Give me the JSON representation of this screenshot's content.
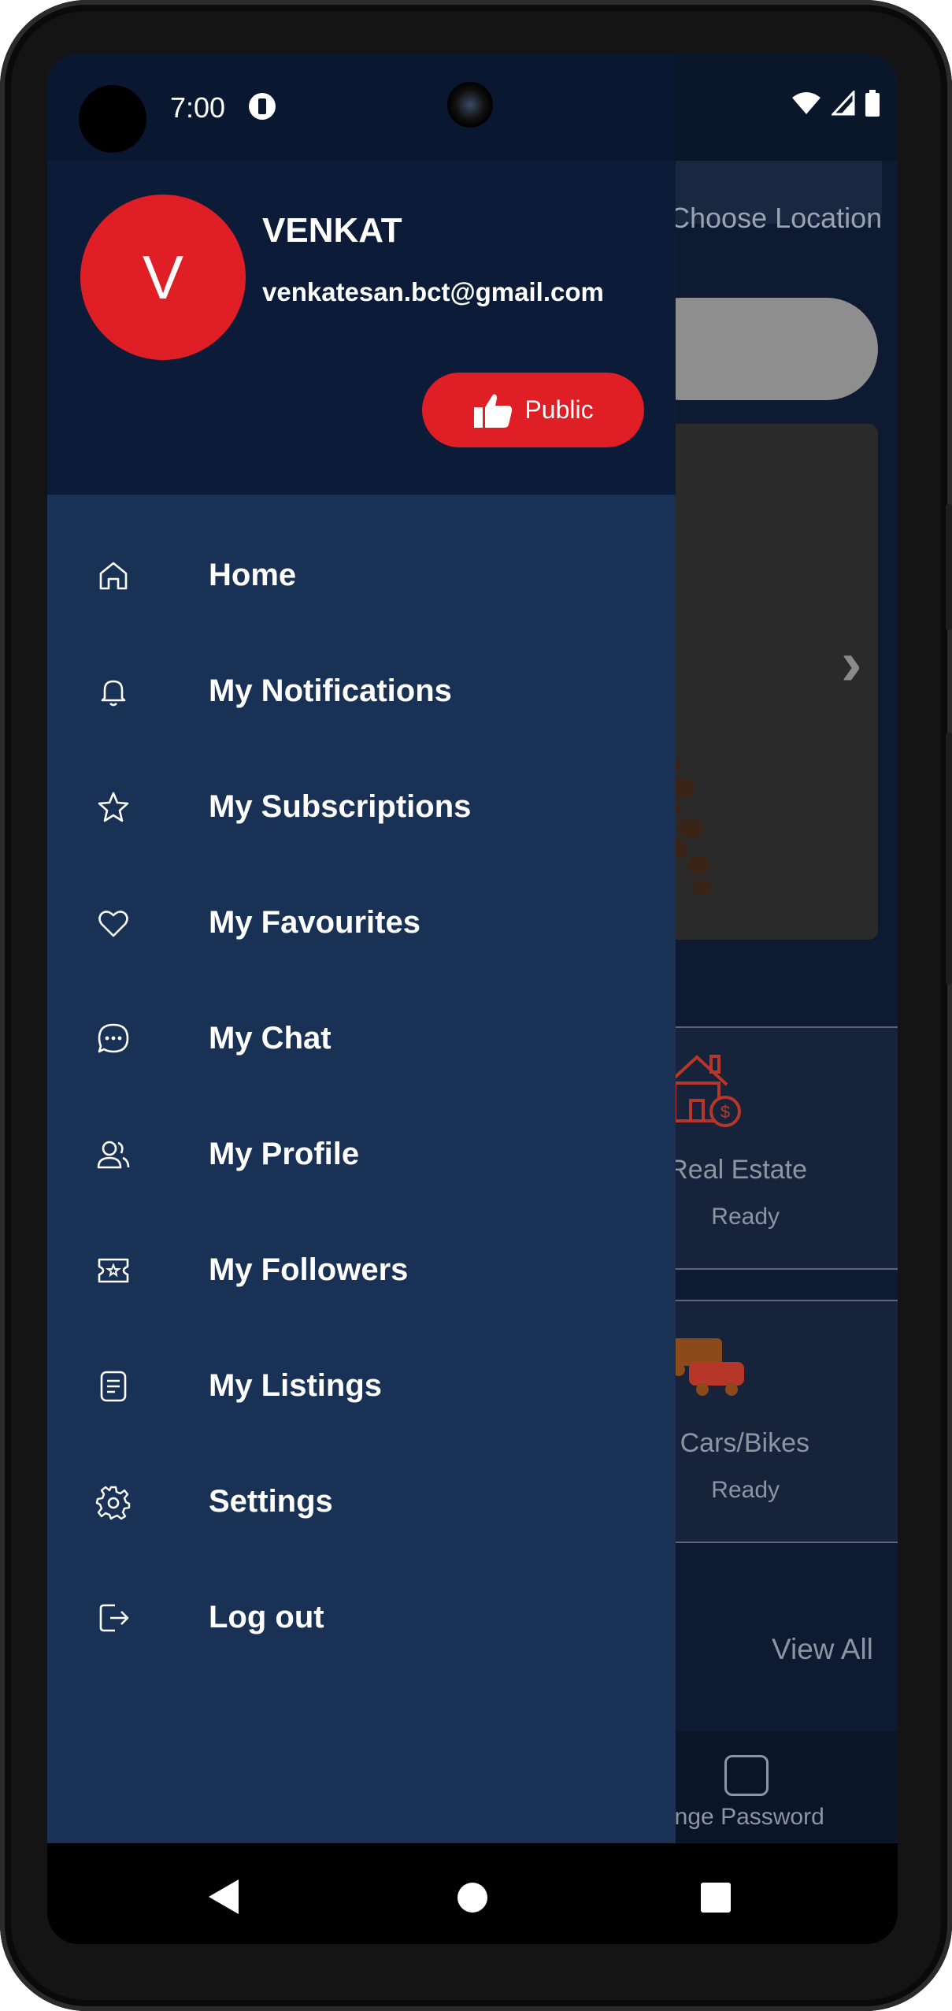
{
  "status_bar": {
    "time": "7:00"
  },
  "background": {
    "location_text": "Choose Location",
    "categories": [
      {
        "label": "Real Estate",
        "status": "Ready"
      },
      {
        "label": "Cars/Bikes",
        "status": "Ready"
      }
    ],
    "view_all": "View All",
    "bottom_nav_label": "ange Password"
  },
  "drawer": {
    "avatar_initial": "V",
    "user_name": "VENKAT",
    "user_email": "venkatesan.bct@gmail.com",
    "public_label": "Public",
    "menu": [
      {
        "label": "Home",
        "icon": "home-icon"
      },
      {
        "label": "My Notifications",
        "icon": "bell-icon"
      },
      {
        "label": "My Subscriptions",
        "icon": "star-icon"
      },
      {
        "label": "My Favourites",
        "icon": "heart-icon"
      },
      {
        "label": "My Chat",
        "icon": "chat-icon"
      },
      {
        "label": "My Profile",
        "icon": "profile-icon"
      },
      {
        "label": "My Followers",
        "icon": "followers-icon"
      },
      {
        "label": "My Listings",
        "icon": "listings-icon"
      },
      {
        "label": "Settings",
        "icon": "gear-icon"
      },
      {
        "label": "Log out",
        "icon": "logout-icon"
      }
    ]
  },
  "colors": {
    "accent": "#e01e26",
    "drawer_bg": "#1a3156",
    "header_bg": "#0c1b37"
  }
}
